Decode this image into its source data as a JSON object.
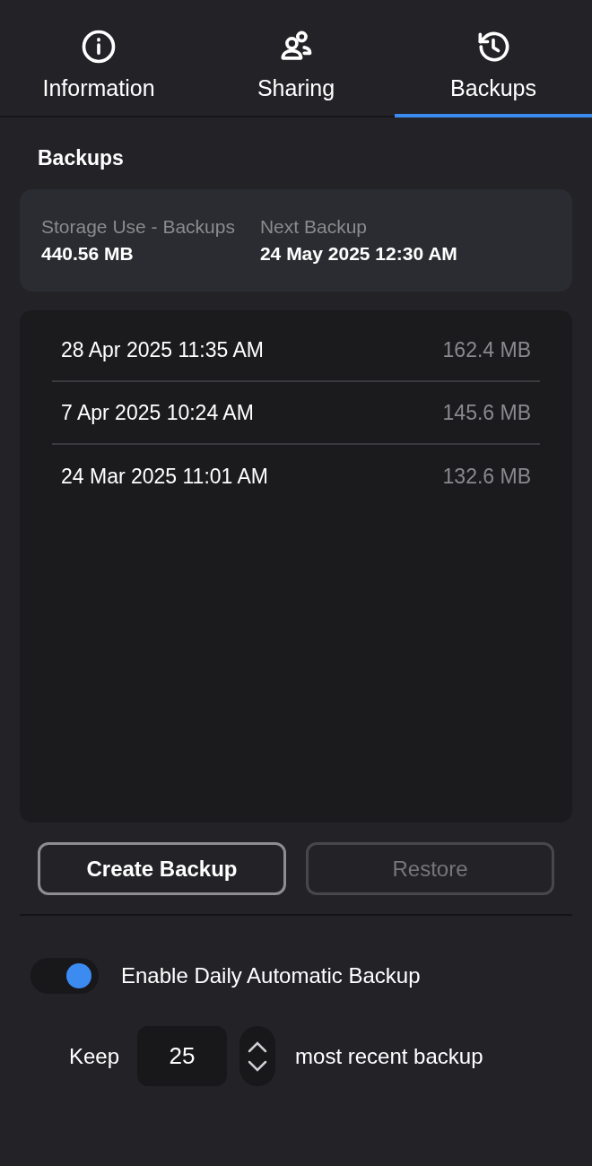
{
  "tabs": [
    {
      "label": "Information",
      "kind": "info",
      "selected": false
    },
    {
      "label": "Sharing",
      "kind": "people",
      "selected": false
    },
    {
      "label": "Backups",
      "kind": "history",
      "selected": true
    }
  ],
  "section_title": "Backups",
  "summary": [
    {
      "label": "Storage Use - Backups",
      "value": "440.56 MB"
    },
    {
      "label": "Next Backup",
      "value": "24 May 2025 12:30 AM"
    }
  ],
  "backups": [
    {
      "date": "28 Apr 2025 11:35 AM",
      "size": "162.4 MB"
    },
    {
      "date": "7 Apr 2025 10:24 AM",
      "size": "145.6 MB"
    },
    {
      "date": "24 Mar 2025 11:01 AM",
      "size": "132.6 MB"
    }
  ],
  "buttons": [
    {
      "label": "Create Backup",
      "disabled": false
    },
    {
      "label": "Restore",
      "disabled": true
    }
  ],
  "auto_backup": {
    "label": "Enable Daily Automatic Backup",
    "on": true
  },
  "keep": {
    "prefix": "Keep",
    "value": "25",
    "suffix": "most recent backup"
  }
}
